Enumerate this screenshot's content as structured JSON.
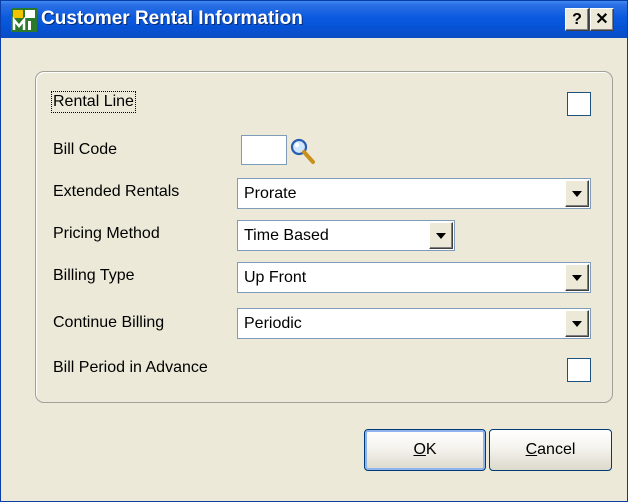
{
  "window": {
    "title": "Customer Rental Information",
    "help_label": "?",
    "close_label": "✕"
  },
  "form": {
    "rental_line": {
      "label": "Rental Line",
      "checked": false
    },
    "bill_code": {
      "label": "Bill Code",
      "value": ""
    },
    "extended_rentals": {
      "label": "Extended Rentals",
      "value": "Prorate"
    },
    "pricing_method": {
      "label": "Pricing Method",
      "value": "Time Based"
    },
    "billing_type": {
      "label": "Billing Type",
      "value": "Up Front"
    },
    "continue_billing": {
      "label": "Continue Billing",
      "value": "Periodic"
    },
    "bill_period_in_advance": {
      "label": "Bill Period in Advance",
      "checked": false
    }
  },
  "buttons": {
    "ok_mnemonic": "O",
    "ok_rest": "K",
    "cancel_mnemonic": "C",
    "cancel_rest": "ancel"
  },
  "icons": {
    "app": "app-icon",
    "lookup": "magnifier-icon",
    "dropdown": "dropdown-arrow-icon"
  }
}
